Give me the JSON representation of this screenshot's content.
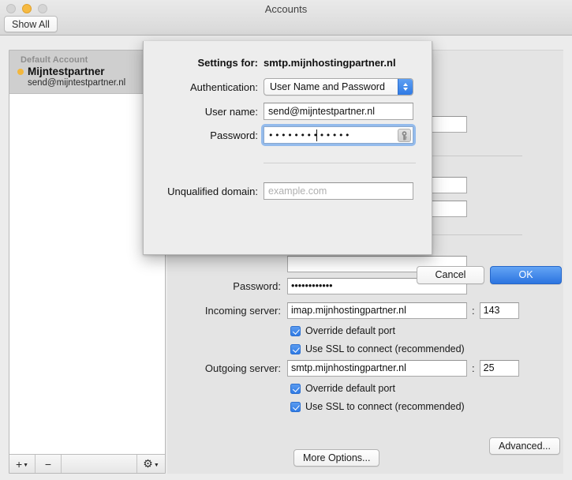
{
  "window": {
    "title": "Accounts",
    "show_all_label": "Show All",
    "traffic_lights": [
      "close-button",
      "minimize-button",
      "zoom-button"
    ]
  },
  "sidebar": {
    "group_label": "Default Account",
    "account_name": "Mijntestpartner",
    "account_email": "send@mijntestpartner.nl",
    "status_dot_color": "#f3b73c",
    "footer": {
      "add_label": "+",
      "remove_label": "−",
      "gear_label": "gear"
    }
  },
  "pane": {
    "password_label": "Password:",
    "password_value": "••••••••••••",
    "incoming_label": "Incoming server:",
    "incoming_value": "imap.mijnhostingpartner.nl",
    "incoming_port": "143",
    "outgoing_label": "Outgoing server:",
    "outgoing_value": "smtp.mijnhostingpartner.nl",
    "outgoing_port": "25",
    "colon": ":",
    "override_port_label": "Override default port",
    "use_ssl_label": "Use SSL to connect (recommended)",
    "more_options_label": "More Options...",
    "advanced_label": "Advanced..."
  },
  "sheet": {
    "settings_for_label": "Settings for:",
    "settings_for_value": "smtp.mijnhostingpartner.nl",
    "authentication_label": "Authentication:",
    "authentication_value": "User Name and Password",
    "authentication_options": [
      "User Name and Password"
    ],
    "username_label": "User name:",
    "username_value": "send@mijntestpartner.nl",
    "password_label": "Password:",
    "password_value": "•••••••••••••",
    "unqualified_label": "Unqualified domain:",
    "unqualified_value": "",
    "unqualified_placeholder": "example.com",
    "cancel_label": "Cancel",
    "ok_label": "OK",
    "accent_color": "#2c74e0"
  }
}
